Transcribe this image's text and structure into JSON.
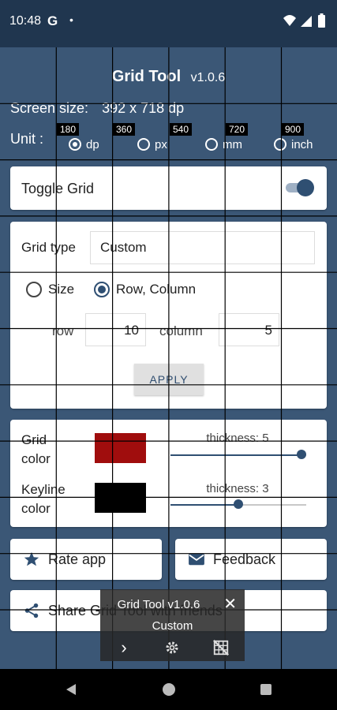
{
  "status_bar": {
    "time": "10:48",
    "google": "G",
    "dot": "•",
    "icons": [
      "wifi-icon",
      "signal-icon",
      "battery-icon"
    ]
  },
  "header": {
    "title": "Grid Tool",
    "version": "v1.0.6"
  },
  "screen": {
    "label": "Screen size:",
    "value": "392 x 718 dp"
  },
  "unit": {
    "label": "Unit :",
    "options": [
      "dp",
      "px",
      "mm",
      "inch"
    ],
    "selected": "dp"
  },
  "grid_ticks": [
    "180",
    "360",
    "540",
    "720",
    "900"
  ],
  "toggle_card": {
    "label": "Toggle Grid",
    "on": true
  },
  "grid_type_card": {
    "label": "Grid type",
    "value": "Custom",
    "mode_options": [
      "Size",
      "Row, Column"
    ],
    "mode_selected": "Row, Column",
    "row_label": "row",
    "row_value": "10",
    "column_label": "column",
    "column_value": "5",
    "apply_label": "APPLY"
  },
  "color_card": {
    "grid_color_label": [
      "Grid",
      "color"
    ],
    "grid_color": "#a00d0d",
    "grid_thickness_label": "thickness: 5",
    "grid_thickness_fraction": 1.0,
    "keyline_color_label": [
      "Keyline",
      "color"
    ],
    "keyline_color": "#000000",
    "keyline_thickness_label": "thickness: 3",
    "keyline_thickness_fraction": 0.5
  },
  "actions": {
    "rate": "Rate app",
    "feedback": "Feedback",
    "share": "Share Grid Tool with friends"
  },
  "overlay": {
    "title": "Grid Tool v1.0.6",
    "subtitle": "Custom",
    "close": "✕",
    "next": "›"
  },
  "colors": {
    "background": "#3b5776",
    "status_bar": "#20364f",
    "accent": "#2f4f72",
    "slider_track": "#2f4f72"
  }
}
